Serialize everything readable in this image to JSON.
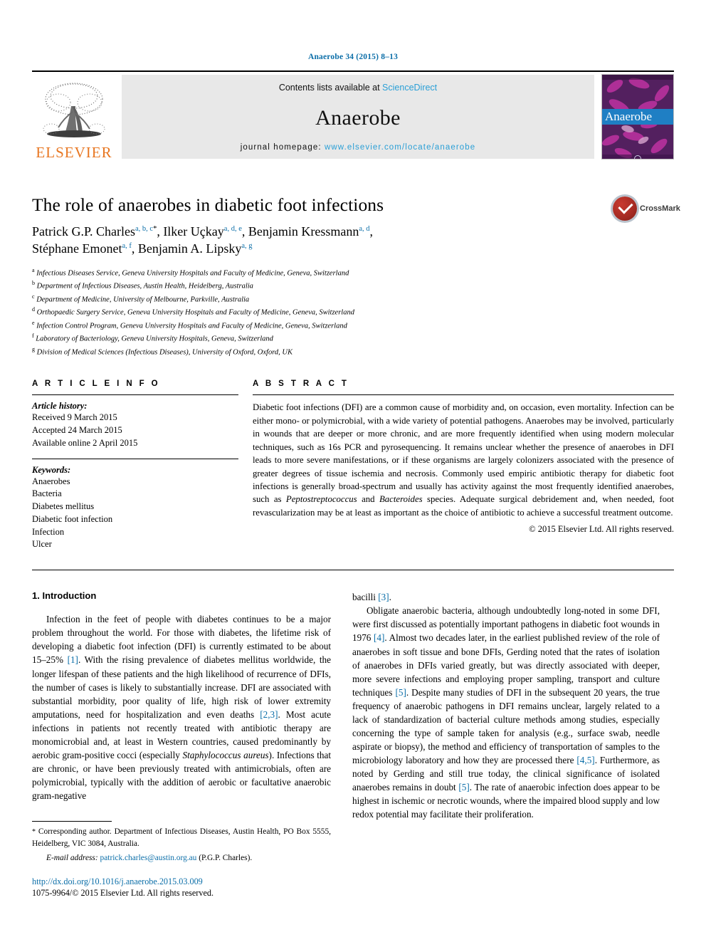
{
  "running_head": "Anaerobe 34 (2015) 8–13",
  "masthead": {
    "publisher": "ELSEVIER",
    "contents_prefix": "Contents lists available at ",
    "contents_link": "ScienceDirect",
    "journal_title": "Anaerobe",
    "homepage_prefix": "journal homepage: ",
    "homepage_url": "www.elsevier.com/locate/anaerobe",
    "cover_title": "Anaerobe"
  },
  "article": {
    "title": "The role of anaerobes in diabetic foot infections",
    "authors_line1_a": "Patrick G.P. Charles",
    "authors_line1_a_sup": "a, b, c",
    "authors_line1_b": ", Ilker Uçkay",
    "authors_line1_b_sup": "a, d, e",
    "authors_line1_c": ", Benjamin Kressmann",
    "authors_line1_c_sup": "a, d",
    "authors_line2_a": "Stéphane Emonet",
    "authors_line2_a_sup": "a, f",
    "authors_line2_b": ", Benjamin A. Lipsky",
    "authors_line2_b_sup": "a, g",
    "crossmark_label": "CrossMark",
    "affiliations": [
      {
        "marker": "a",
        "text": "Infectious Diseases Service, Geneva University Hospitals and Faculty of Medicine, Geneva, Switzerland"
      },
      {
        "marker": "b",
        "text": "Department of Infectious Diseases, Austin Health, Heidelberg, Australia"
      },
      {
        "marker": "c",
        "text": "Department of Medicine, University of Melbourne, Parkville, Australia"
      },
      {
        "marker": "d",
        "text": "Orthopaedic Surgery Service, Geneva University Hospitals and Faculty of Medicine, Geneva, Switzerland"
      },
      {
        "marker": "e",
        "text": "Infection Control Program, Geneva University Hospitals and Faculty of Medicine, Geneva, Switzerland"
      },
      {
        "marker": "f",
        "text": "Laboratory of Bacteriology, Geneva University Hospitals, Geneva, Switzerland"
      },
      {
        "marker": "g",
        "text": "Division of Medical Sciences (Infectious Diseases), University of Oxford, Oxford, UK"
      }
    ]
  },
  "article_info": {
    "heading": "A R T I C L E   I N F O",
    "history_label": "Article history:",
    "history": [
      "Received 9 March 2015",
      "Accepted 24 March 2015",
      "Available online 2 April 2015"
    ],
    "keywords_label": "Keywords:",
    "keywords": [
      "Anaerobes",
      "Bacteria",
      "Diabetes mellitus",
      "Diabetic foot infection",
      "Infection",
      "Ulcer"
    ]
  },
  "abstract": {
    "heading": "A B S T R A C T",
    "p1": "Diabetic foot infections (DFI) are a common cause of morbidity and, on occasion, even mortality. Infection can be either mono- or polymicrobial, with a wide variety of potential pathogens. Anaerobes may be involved, particularly in wounds that are deeper or more chronic, and are more frequently identified when using modern molecular techniques, such as 16s PCR and pyrosequencing. It remains unclear whether the presence of anaerobes in DFI leads to more severe manifestations, or if these organisms are largely colonizers associated with the presence of greater degrees of tissue ischemia and necrosis. Commonly used empiric antibiotic therapy for diabetic foot infections is generally broad-spectrum and usually has activity against the most frequently identified anaerobes, such as ",
    "p1_italic_1": "Peptostreptococcus",
    "p1_mid": " and ",
    "p1_italic_2": "Bacteroides",
    "p1_end": " species. Adequate surgical debridement and, when needed, foot revascularization may be at least as important as the choice of antibiotic to achieve a successful treatment outcome.",
    "copyright": "© 2015 Elsevier Ltd. All rights reserved."
  },
  "body": {
    "section_heading": "1. Introduction",
    "left_p1_a": "Infection in the feet of people with diabetes continues to be a major problem throughout the world. For those with diabetes, the lifetime risk of developing a diabetic foot infection (DFI) is currently estimated to be about 15–25% ",
    "left_p1_ref1": "[1]",
    "left_p1_b": ". With the rising prevalence of diabetes mellitus worldwide, the longer lifespan of these patients and the high likelihood of recurrence of DFIs, the number of cases is likely to substantially increase. DFI are associated with substantial morbidity, poor quality of life, high risk of lower extremity amputations, need for hospitalization and even deaths ",
    "left_p1_ref2": "[2,3]",
    "left_p1_c": ". Most acute infections in patients not recently treated with antibiotic therapy are monomicrobial and, at least in Western countries, caused predominantly by aerobic gram-positive cocci (especially ",
    "left_p1_italic": "Staphylococcus aureus",
    "left_p1_d": "). Infections that are chronic, or have been previously treated with antimicrobials, often are polymicrobial, typically with the addition of aerobic or facultative anaerobic gram-negative",
    "right_p0_a": "bacilli ",
    "right_p0_ref": "[3]",
    "right_p0_b": ".",
    "right_p1_a": "Obligate anaerobic bacteria, although undoubtedly long-noted in some DFI, were first discussed as potentially important pathogens in diabetic foot wounds in 1976 ",
    "right_p1_ref1": "[4]",
    "right_p1_b": ". Almost two decades later, in the earliest published review of the role of anaerobes in soft tissue and bone DFIs, Gerding noted that the rates of isolation of anaerobes in DFIs varied greatly, but was directly associated with deeper, more severe infections and employing proper sampling, transport and culture techniques ",
    "right_p1_ref2": "[5]",
    "right_p1_c": ". Despite many studies of DFI in the subsequent 20 years, the true frequency of anaerobic pathogens in DFI remains unclear, largely related to a lack of standardization of bacterial culture methods among studies, especially concerning the type of sample taken for analysis (e.g., surface swab, needle aspirate or biopsy), the method and efficiency of transportation of samples to the microbiology laboratory and how they are processed there ",
    "right_p1_ref3": "[4,5]",
    "right_p1_d": ". Furthermore, as noted by Gerding and still true today, the clinical significance of isolated anaerobes remains in doubt ",
    "right_p1_ref4": "[5]",
    "right_p1_e": ". The rate of anaerobic infection does appear to be highest in ischemic or necrotic wounds, where the impaired blood supply and low redox potential may facilitate their proliferation."
  },
  "footer": {
    "corresponding_star": "*",
    "corresponding_text": " Corresponding author. Department of Infectious Diseases, Austin Health, PO Box 5555, Heidelberg, VIC 3084, Australia.",
    "email_label": "E-mail address:",
    "email": "patrick.charles@austin.org.au",
    "email_suffix": " (P.G.P. Charles).",
    "doi": "http://dx.doi.org/10.1016/j.anaerobe.2015.03.009",
    "issn": "1075-9964/© 2015 Elsevier Ltd. All rights reserved."
  },
  "colors": {
    "link_blue": "#0b6ea8",
    "sciencedirect_blue": "#2a9fd6",
    "elsevier_orange": "#E87722"
  }
}
